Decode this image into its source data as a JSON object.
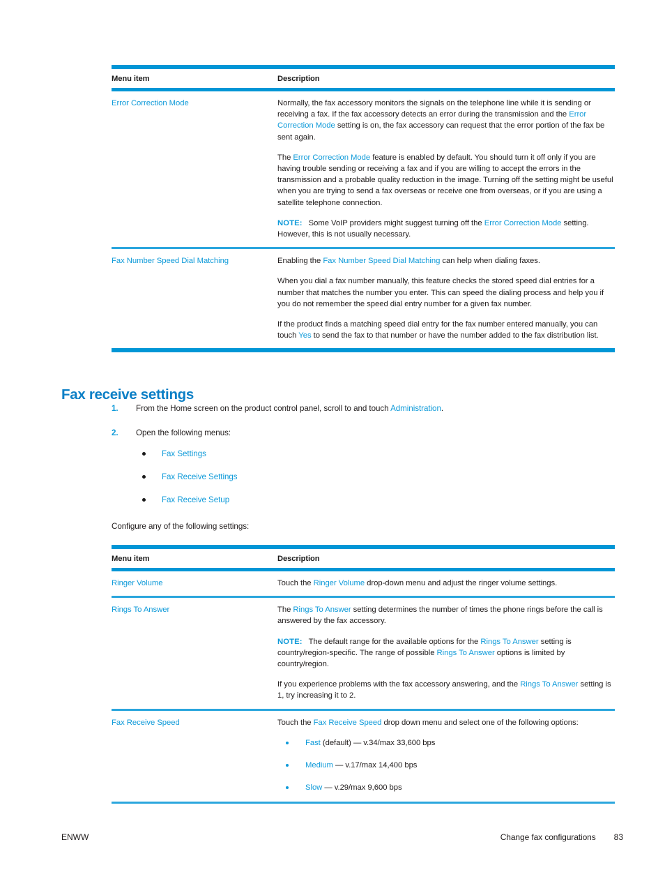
{
  "colors": {
    "link_blue": "#0e9ad9",
    "rule_blue": "#0096d6",
    "heading_blue": "#0b7fc6",
    "body_text": "#201c1c"
  },
  "table_one": {
    "headers": {
      "menu_item": "Menu item",
      "description": "Description"
    },
    "rows": [
      {
        "menu_item": "Error Correction Mode",
        "paragraphs": [
          {
            "segments": [
              {
                "text": "Normally, the fax accessory monitors the signals on the telephone line while it is sending or receiving a fax. If the fax accessory detects an error during the transmission and the ",
                "style": "plain"
              },
              {
                "text": "Error Correction Mode",
                "style": "link"
              },
              {
                "text": " setting is on, the fax accessory can request that the error portion of the fax be sent again.",
                "style": "plain"
              }
            ]
          },
          {
            "segments": [
              {
                "text": "The ",
                "style": "plain"
              },
              {
                "text": "Error Correction Mode",
                "style": "link"
              },
              {
                "text": " feature is enabled by default. You should turn it off only if you are having trouble sending or receiving a fax and if you are willing to accept the errors in the transmission and a probable quality reduction in the image. Turning off the setting might be useful when you are trying to send a fax overseas or receive one from overseas, or if you are using a satellite telephone connection.",
                "style": "plain"
              }
            ]
          },
          {
            "note_label": "NOTE:",
            "segments": [
              {
                "text": "Some VoIP providers might suggest turning off the ",
                "style": "plain"
              },
              {
                "text": "Error Correction Mode",
                "style": "link"
              },
              {
                "text": " setting. However, this is not usually necessary.",
                "style": "plain"
              }
            ]
          }
        ]
      },
      {
        "menu_item": "Fax Number Speed Dial Matching",
        "paragraphs": [
          {
            "segments": [
              {
                "text": "Enabling the ",
                "style": "plain"
              },
              {
                "text": "Fax Number Speed Dial Matching",
                "style": "link"
              },
              {
                "text": " can help when dialing faxes.",
                "style": "plain"
              }
            ]
          },
          {
            "segments": [
              {
                "text": "When you dial a fax number manually, this feature checks the stored speed dial entries for a number that matches the number you enter. This can speed the dialing process and help you if you do not remember the speed dial entry number for a given fax number.",
                "style": "plain"
              }
            ]
          },
          {
            "segments": [
              {
                "text": "If the product finds a matching speed dial entry for the fax number entered manually, you can touch ",
                "style": "plain"
              },
              {
                "text": "Yes",
                "style": "link"
              },
              {
                "text": " to send the fax to that number or have the number added to the fax distribution list.",
                "style": "plain"
              }
            ]
          }
        ]
      }
    ]
  },
  "section": {
    "heading": "Fax receive settings",
    "steps": [
      {
        "marker": "1.",
        "segments": [
          {
            "text": "From the Home screen on the product control panel, scroll to and touch ",
            "style": "plain"
          },
          {
            "text": "Administration",
            "style": "link"
          },
          {
            "text": ".",
            "style": "plain"
          }
        ]
      },
      {
        "marker": "2.",
        "segments": [
          {
            "text": "Open the following menus:",
            "style": "plain"
          }
        ],
        "menus": [
          "Fax Settings",
          "Fax Receive Settings",
          "Fax Receive Setup"
        ]
      }
    ],
    "configure_line": "Configure any of the following settings:"
  },
  "table_two": {
    "headers": {
      "menu_item": "Menu item",
      "description": "Description"
    },
    "rows": [
      {
        "menu_item": "Ringer Volume",
        "paragraphs": [
          {
            "segments": [
              {
                "text": "Touch the ",
                "style": "plain"
              },
              {
                "text": "Ringer Volume",
                "style": "link"
              },
              {
                "text": " drop-down menu and adjust the ringer volume settings.",
                "style": "plain"
              }
            ]
          }
        ]
      },
      {
        "menu_item": "Rings To Answer",
        "paragraphs": [
          {
            "segments": [
              {
                "text": "The ",
                "style": "plain"
              },
              {
                "text": "Rings To Answer",
                "style": "link"
              },
              {
                "text": " setting determines the number of times the phone rings before the call is answered by the fax accessory.",
                "style": "plain"
              }
            ]
          },
          {
            "note_label": "NOTE:",
            "segments": [
              {
                "text": "The default range for the available options for the ",
                "style": "plain"
              },
              {
                "text": "Rings To Answer",
                "style": "link"
              },
              {
                "text": " setting is country/region-specific. The range of possible ",
                "style": "plain"
              },
              {
                "text": "Rings To Answer",
                "style": "link"
              },
              {
                "text": " options is limited by country/region.",
                "style": "plain"
              }
            ]
          },
          {
            "segments": [
              {
                "text": "If you experience problems with the fax accessory answering, and the ",
                "style": "plain"
              },
              {
                "text": "Rings To Answer",
                "style": "link"
              },
              {
                "text": " setting is ",
                "style": "plain"
              },
              {
                "text": "1",
                "style": "bold"
              },
              {
                "text": ", try increasing it to ",
                "style": "plain"
              },
              {
                "text": "2",
                "style": "bold"
              },
              {
                "text": ".",
                "style": "plain"
              }
            ]
          }
        ]
      },
      {
        "menu_item": "Fax Receive Speed",
        "paragraphs": [
          {
            "segments": [
              {
                "text": "Touch the ",
                "style": "plain"
              },
              {
                "text": "Fax Receive Speed",
                "style": "link"
              },
              {
                "text": " drop down menu and select one of the following options:",
                "style": "plain"
              }
            ]
          }
        ],
        "options": [
          {
            "segments": [
              {
                "text": "Fast",
                "style": "link"
              },
              {
                "text": " (default) — v.34/max 33,600 bps",
                "style": "plain"
              }
            ]
          },
          {
            "segments": [
              {
                "text": "Medium",
                "style": "link"
              },
              {
                "text": " — v.17/max 14,400 bps",
                "style": "plain"
              }
            ]
          },
          {
            "segments": [
              {
                "text": "Slow",
                "style": "link"
              },
              {
                "text": " — v.29/max 9,600 bps",
                "style": "plain"
              }
            ]
          }
        ]
      }
    ]
  },
  "footer": {
    "left": "ENWW",
    "chapter": "Change fax configurations",
    "page_number": "83"
  }
}
